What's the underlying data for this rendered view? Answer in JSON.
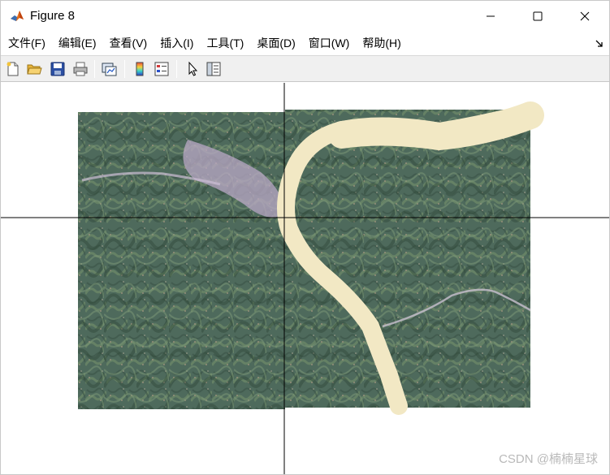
{
  "window": {
    "title": "Figure 8",
    "app_icon": "matlab-icon",
    "controls": {
      "minimize": "minimize-icon",
      "maximize": "maximize-icon",
      "close": "close-icon"
    }
  },
  "menubar": {
    "items": [
      {
        "label": "文件(F)"
      },
      {
        "label": "编辑(E)"
      },
      {
        "label": "查看(V)"
      },
      {
        "label": "插入(I)"
      },
      {
        "label": "工具(T)"
      },
      {
        "label": "桌面(D)"
      },
      {
        "label": "窗口(W)"
      },
      {
        "label": "帮助(H)"
      }
    ],
    "dock_icon": "dock-arrow-icon"
  },
  "toolbar": {
    "buttons": [
      {
        "icon": "new-figure-icon"
      },
      {
        "icon": "open-file-icon"
      },
      {
        "icon": "save-icon"
      },
      {
        "icon": "print-icon"
      },
      {
        "icon": "link-plot-icon"
      },
      {
        "icon": "insert-colorbar-icon"
      },
      {
        "icon": "insert-legend-icon"
      },
      {
        "icon": "edit-plot-pointer-icon"
      },
      {
        "icon": "property-inspector-icon"
      }
    ]
  },
  "figure": {
    "content": "satellite-image-river-valley",
    "crosshair_color": "#000000",
    "image_colors": {
      "forest": "#4e6a5c",
      "ridge": "#6f8a6a",
      "river": "#f2e8c4",
      "town": "#b9a8c6"
    }
  },
  "watermark": {
    "text": "CSDN @楠楠星球"
  }
}
